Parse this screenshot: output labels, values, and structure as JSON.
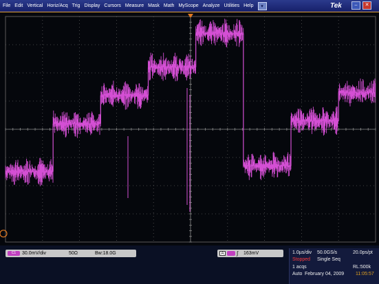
{
  "menu": {
    "items": [
      "File",
      "Edit",
      "Vertical",
      "Horiz/Acq",
      "Trig",
      "Display",
      "Cursors",
      "Measure",
      "Mask",
      "Math",
      "MyScope",
      "Analyze",
      "Utilities",
      "Help"
    ],
    "dropdown_arrow": "▾",
    "brand": "Tek",
    "minimize_icon": "minimize-icon",
    "close_icon": "close-icon"
  },
  "scope": {
    "trace_color": "#d44fd4",
    "grid_color": "#5a5a5a",
    "trigger_marker_color": "#e07820",
    "ground_marker_label": "1",
    "waveform_levels": [
      {
        "from_div": 0.0,
        "to_div": 0.9,
        "level_div": -1.5
      },
      {
        "from_div": 0.9,
        "to_div": 1.8,
        "level_div": 0.2
      },
      {
        "from_div": 1.8,
        "to_div": 2.7,
        "level_div": 1.2
      },
      {
        "from_div": 2.7,
        "to_div": 3.6,
        "level_div": 2.2
      },
      {
        "from_div": 3.6,
        "to_div": 4.5,
        "level_div": 3.4
      },
      {
        "from_div": 4.5,
        "to_div": 5.4,
        "level_div": -1.3
      },
      {
        "from_div": 5.4,
        "to_div": 6.3,
        "level_div": 0.3
      },
      {
        "from_div": 6.3,
        "to_div": 7.0,
        "level_div": 1.3
      }
    ]
  },
  "status": {
    "channel": {
      "badge": "C1",
      "scale": "30.0mV/div",
      "impedance": "50Ω",
      "bandwidth": "Bw:18.0G"
    },
    "trigger": {
      "source_label": "A",
      "edge_symbol": "∫",
      "level": "163mV"
    },
    "acquisition": {
      "time_per_div": "1.0µs/div",
      "sample_rate": "50.0GS/s",
      "resolution": "20.0ps/pt",
      "state": "Stopped",
      "mode": "Single Seq",
      "acqs": "1 acqs",
      "record_length": "RL:500k",
      "trigger_mode": "Auto",
      "date": "February 04, 2009",
      "time": "11:05:57"
    }
  }
}
